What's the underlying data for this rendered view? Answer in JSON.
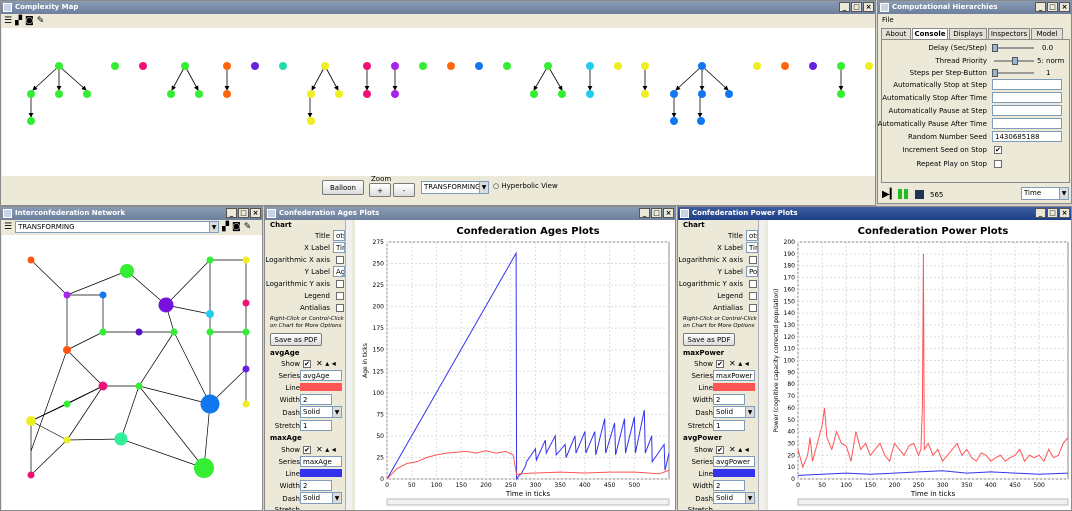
{
  "complexity_map": {
    "title": "Complexity Map",
    "balloon_label": "Balloon",
    "zoom_label": "Zoom",
    "zoom_in": "+",
    "zoom_out": "-",
    "mode_value": "TRANSFORMING",
    "hyperbolic_label": "Hyperbolic View"
  },
  "hierarchies": {
    "title": "Computational Hierarchies",
    "menu_file": "File",
    "tabs": [
      "About",
      "Console",
      "Displays",
      "Inspectors",
      "Model"
    ],
    "delay_label": "Delay (Sec/Step)",
    "delay_value": "0.0",
    "priority_label": "Thread Priority",
    "priority_value": "5: norm",
    "steps_label": "Steps per Step-Button",
    "steps_value": "1",
    "stop_at_step": "Automatically Stop at Step",
    "stop_after_time": "Automatically Stop After Time",
    "pause_at_step": "Automatically Pause at Step",
    "pause_after_time": "Automatically Pause After Time",
    "seed_label": "Random Number Seed",
    "seed_value": "1430685188",
    "increment_label": "Increment Seed on Stop",
    "repeat_label": "Repeat Play on Stop",
    "step_count": "565",
    "time_select": "Time"
  },
  "network": {
    "title": "Interconfederation Network",
    "mode_value": "TRANSFORMING"
  },
  "ages": {
    "title": "Confederation Ages Plots",
    "chart_header": "Chart",
    "title_label": "Title",
    "title_value": "ots",
    "xlabel_label": "X Label",
    "xlabel_value": "Tim",
    "logx_label": "Logarithmic X axis",
    "ylabel_label": "Y Label",
    "ylabel_value": "Age",
    "logy_label": "Logarithmic Y axis",
    "legend_label": "Legend",
    "antialias_label": "Antialias",
    "hint1": "Right-Click or Control-Click",
    "hint2": "on Chart for More Options",
    "pdf_button": "Save as PDF",
    "s1_name": "avgAge",
    "s1_series": "avgAge",
    "s2_name": "maxAge",
    "s2_series": "maxAge",
    "show_label": "Show",
    "series_label": "Series",
    "line_label": "Line",
    "width_label": "Width",
    "width_value": "2",
    "dash_label": "Dash",
    "dash_value": "Solid",
    "stretch_label": "Stretch",
    "stretch_value": "1"
  },
  "power": {
    "title": "Confederation Power Plots",
    "chart_header": "Chart",
    "title_label": "Title",
    "title_value": "ots",
    "xlabel_label": "X Label",
    "xlabel_value": "Tim",
    "logx_label": "Logarithmic X axis",
    "ylabel_label": "Y Label",
    "ylabel_value": "Po",
    "logy_label": "Logarithmic Y axis",
    "legend_label": "Legend",
    "antialias_label": "Antialias",
    "hint1": "Right-Click or Control-Click",
    "hint2": "on Chart for More Options",
    "pdf_button": "Save as PDF",
    "s1_name": "maxPower",
    "s1_series": "maxPower",
    "s2_name": "avgPower",
    "s2_series": "avgPower",
    "show_label": "Show",
    "series_label": "Series",
    "line_label": "Line",
    "width_label": "Width",
    "width_value": "2",
    "dash_label": "Dash",
    "dash_value": "Solid",
    "stretch_label": "Stretch",
    "stretch_value": "1"
  },
  "colors": {
    "red": "#ff5555",
    "blue": "#3333ee",
    "accent": "#1f3f86"
  },
  "chart_data": [
    {
      "type": "line",
      "title": "Confederation Ages Plots",
      "xlabel": "Time in ticks",
      "ylabel": "Age in ticks",
      "xlim": [
        0,
        570
      ],
      "ylim": [
        0,
        275
      ],
      "xticks": [
        0,
        50,
        100,
        150,
        200,
        250,
        300,
        350,
        400,
        450,
        500
      ],
      "yticks": [
        0,
        25,
        50,
        75,
        100,
        125,
        150,
        175,
        200,
        225,
        250,
        275
      ],
      "grid": true,
      "series": [
        {
          "name": "maxAge",
          "color": "#3333ee",
          "x": [
            0,
            261,
            262,
            268,
            270,
            280,
            282,
            300,
            302,
            320,
            322,
            340,
            342,
            360,
            362,
            380,
            382,
            400,
            402,
            420,
            422,
            440,
            442,
            460,
            462,
            480,
            482,
            500,
            502,
            520,
            522,
            535,
            536,
            560,
            562,
            570
          ],
          "y": [
            0,
            262,
            0,
            5,
            5,
            15,
            20,
            35,
            22,
            45,
            30,
            50,
            28,
            40,
            25,
            50,
            30,
            55,
            30,
            55,
            28,
            70,
            30,
            65,
            28,
            70,
            30,
            72,
            30,
            80,
            30,
            50,
            20,
            40,
            10,
            30
          ]
        },
        {
          "name": "avgAge",
          "color": "#ff5555",
          "x": [
            0,
            20,
            40,
            60,
            80,
            100,
            120,
            140,
            160,
            180,
            200,
            220,
            240,
            255,
            262,
            270,
            300,
            350,
            400,
            450,
            500,
            550,
            570
          ],
          "y": [
            0,
            12,
            18,
            20,
            25,
            28,
            30,
            31,
            32,
            30,
            33,
            30,
            32,
            28,
            5,
            6,
            7,
            8,
            7,
            8,
            8,
            6,
            10
          ]
        }
      ]
    },
    {
      "type": "line",
      "title": "Confederation Power Plots",
      "xlabel": "Time in ticks",
      "ylabel": "Power (cognitive capacity corrected population)",
      "xlim": [
        0,
        560
      ],
      "ylim": [
        0,
        200
      ],
      "xticks": [
        0,
        50,
        100,
        150,
        200,
        250,
        300,
        350,
        400,
        450,
        500
      ],
      "yticks": [
        0,
        10,
        20,
        30,
        40,
        50,
        60,
        70,
        80,
        90,
        100,
        110,
        120,
        130,
        140,
        150,
        160,
        170,
        180,
        190,
        200
      ],
      "grid": true,
      "series": [
        {
          "name": "maxPower",
          "color": "#ff5555",
          "x": [
            0,
            10,
            20,
            25,
            30,
            40,
            50,
            55,
            60,
            70,
            80,
            90,
            100,
            110,
            120,
            130,
            140,
            150,
            160,
            170,
            180,
            190,
            200,
            210,
            220,
            230,
            240,
            250,
            255,
            258,
            260,
            262,
            270,
            280,
            290,
            300,
            310,
            320,
            330,
            340,
            350,
            360,
            370,
            380,
            390,
            400,
            410,
            420,
            430,
            440,
            450,
            460,
            470,
            480,
            490,
            500,
            510,
            520,
            530,
            540,
            550,
            560
          ],
          "y": [
            25,
            10,
            20,
            35,
            15,
            30,
            45,
            60,
            35,
            25,
            40,
            30,
            28,
            15,
            40,
            25,
            30,
            20,
            25,
            30,
            20,
            15,
            30,
            25,
            20,
            28,
            30,
            20,
            25,
            60,
            190,
            25,
            30,
            20,
            25,
            15,
            20,
            25,
            30,
            20,
            25,
            18,
            15,
            22,
            20,
            15,
            18,
            20,
            15,
            18,
            20,
            25,
            15,
            20,
            18,
            20,
            15,
            25,
            18,
            20,
            30,
            35
          ]
        },
        {
          "name": "avgPower",
          "color": "#3333ee",
          "x": [
            0,
            50,
            100,
            150,
            200,
            250,
            300,
            350,
            400,
            450,
            500,
            560
          ],
          "y": [
            3,
            4,
            5,
            4,
            5,
            6,
            7,
            5,
            6,
            5,
            4,
            5
          ]
        }
      ]
    }
  ]
}
